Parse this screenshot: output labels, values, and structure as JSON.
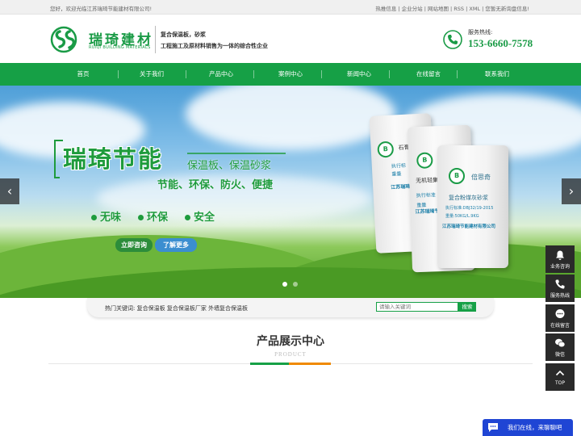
{
  "topbar": {
    "welcome": "您好，欢迎光临江苏瑞琦节能建材有限公司!",
    "links": "热推信息 | 企业分站 | 网站地图 | RSS | XML | 您暂无新询盘信息!"
  },
  "header": {
    "logo_cn": "瑞琦建材",
    "logo_en": "RUIQI BUILDING MATERIALS",
    "slogan_line1": "复合保温板，砂浆",
    "slogan_line2": "工程施工及原材料销售为一体的综合性企业",
    "hotline_label": "服务热线:",
    "hotline_number": "153-6660-7578"
  },
  "nav": {
    "items": [
      {
        "label": "首页"
      },
      {
        "label": "关于我们"
      },
      {
        "label": "产品中心"
      },
      {
        "label": "案例中心"
      },
      {
        "label": "新闻中心"
      },
      {
        "label": "在线留言"
      },
      {
        "label": "联系我们"
      }
    ]
  },
  "banner": {
    "title": "瑞琦节能",
    "subtitle1": "保温板、保温砂浆",
    "subtitle2": "节能、环保、防火、便捷",
    "features": [
      "无味",
      "环保",
      "安全"
    ],
    "consult_button": "立即咨询",
    "more_button": "了解更多",
    "bag_front_brand": "倍思奇",
    "bag_front_product": "复合粉煤灰砂浆",
    "bag_front_std": "执行标准:DBJ32/19-2015",
    "bag_front_weight": "重量:50KG/L.9KG",
    "bag_front_company": "江苏瑞琦节能建材有限公司",
    "bag_middle_product": "无机轻集",
    "bag_middle_std": "执行标准",
    "bag_middle_weight": "重量",
    "bag_middle_company": "江苏瑞琦节能",
    "bag_back_product": "石膏",
    "bag_back_std": "执行标",
    "bag_back_weight": "重量",
    "bag_back_company": "江苏瑞琦节",
    "prev_arrow": "‹",
    "next_arrow": "›"
  },
  "search": {
    "hot_label": "热门关键词:",
    "hot_keywords": [
      "复合保温板",
      "复合保温板厂家",
      "外墙复合保温板"
    ],
    "placeholder": "请输入关键词",
    "button": "搜索"
  },
  "section": {
    "title": "产品展示中心",
    "subtitle": "PRODUCT"
  },
  "sidebar": {
    "items": [
      {
        "label": "业务咨询",
        "icon": "bell-icon"
      },
      {
        "label": "服务热线",
        "icon": "phone-icon"
      },
      {
        "label": "在线留言",
        "icon": "chat-bubble-icon"
      },
      {
        "label": "微信",
        "icon": "wechat-icon"
      },
      {
        "label": "TOP",
        "icon": "chevron-up-icon"
      }
    ]
  },
  "chat": {
    "text": "我们在线，来聊聊吧"
  },
  "colors": {
    "brand_green": "#16a046",
    "accent_orange": "#f08a00",
    "chat_blue": "#1f45d4",
    "toolbar_dark": "#2a2a2a"
  }
}
